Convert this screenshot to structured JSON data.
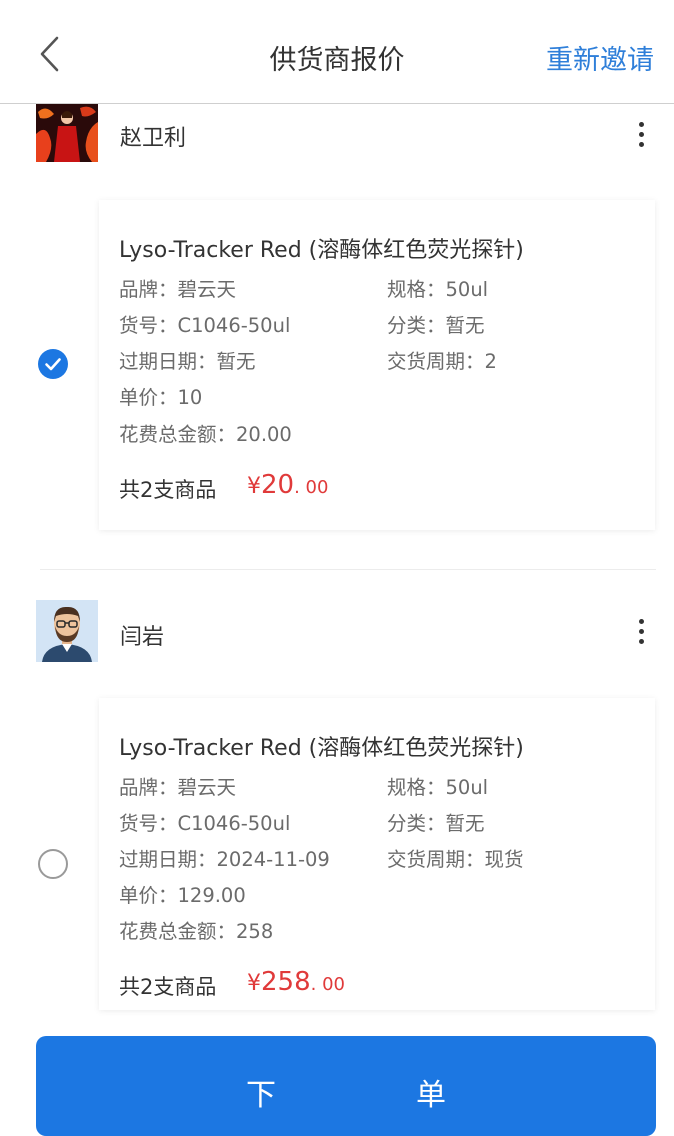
{
  "header": {
    "title": "供货商报价",
    "action_label": "重新邀请"
  },
  "suppliers": [
    {
      "name": "赵卫利",
      "selected": true,
      "product": {
        "title": "Lyso-Tracker Red (溶酶体红色荧光探针)",
        "brand": "品牌：碧云天",
        "spec": "规格：50ul",
        "item_no": "货号：C1046-50ul",
        "category": "分类：暂无",
        "expiry": "过期日期：暂无",
        "delivery": "交货周期：2",
        "unit_price": "单价：10",
        "total_cost": "花费总金额：20.00"
      },
      "summary": {
        "count_text": "共2支商品",
        "currency": "¥",
        "amount_int": "20",
        "amount_dec": ". 00"
      }
    },
    {
      "name": "闫岩",
      "selected": false,
      "product": {
        "title": "Lyso-Tracker Red (溶酶体红色荧光探针)",
        "brand": "品牌：碧云天",
        "spec": "规格：50ul",
        "item_no": "货号：C1046-50ul",
        "category": "分类：暂无",
        "expiry": "过期日期：2024-11-09",
        "delivery": "交货周期：现货",
        "unit_price": "单价：129.00",
        "total_cost": "花费总金额：258"
      },
      "summary": {
        "count_text": "共2支商品",
        "currency": "¥",
        "amount_int": "258",
        "amount_dec": ". 00"
      }
    }
  ],
  "footer": {
    "order_char_1": "下",
    "order_char_2": "单"
  },
  "colors": {
    "accent": "#1c77e2",
    "link": "#2f7fd9",
    "price": "#e03a3a"
  },
  "icons": {
    "back": "chevron-left-icon",
    "more": "more-vertical-icon",
    "check": "check-circle-icon"
  }
}
